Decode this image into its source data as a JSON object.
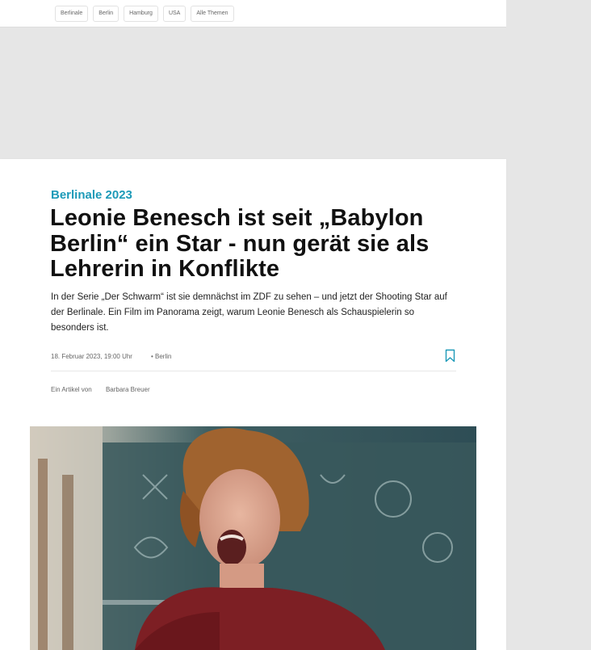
{
  "topics": {
    "tags": [
      "Berlinale",
      "Berlin",
      "Hamburg",
      "USA",
      "Alle Themen"
    ]
  },
  "article": {
    "kicker": "Berlinale 2023",
    "headline": "Leonie Benesch ist seit „Babylon Berlin“ ein Star - nun gerät sie als Lehrerin in Konflikte",
    "teaser": "In der Serie „Der Schwarm“ ist sie demnächst im ZDF zu sehen – und jetzt der Shooting Star auf der Berlinale. Ein Film im Panorama zeigt, warum Leonie Benesch als Schauspielerin so besonders ist.",
    "date": "18. Februar 2023, 19:00 Uhr",
    "separator": "•",
    "location": "Berlin",
    "author_prefix": "Ein Artikel von",
    "author_name": "Barbara Breuer",
    "bookmark_icon": "bookmark-icon"
  },
  "colors": {
    "accent": "#1d9ab8",
    "page_background": "#e6e6e6",
    "card_background": "#ffffff"
  }
}
